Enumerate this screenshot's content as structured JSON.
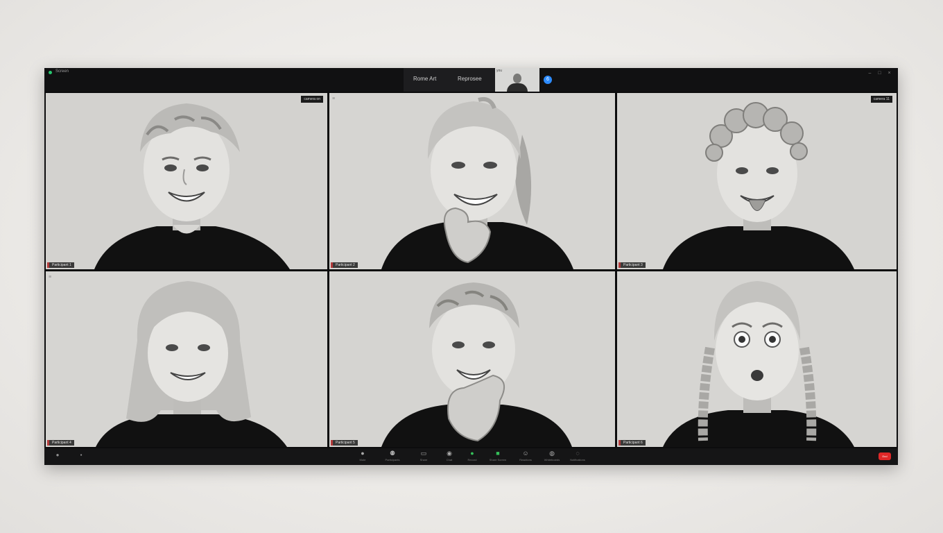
{
  "window": {
    "title": "Screen",
    "nav_left": "Rome Art",
    "nav_right": "Reprosee",
    "self_view_label": "you",
    "participants_badge": "6"
  },
  "colors": {
    "background": "#eceae7",
    "frame": "#0c0c0d",
    "tile_bg": "#d6d5d2",
    "accent_blue": "#2d8cff",
    "end_red": "#e02828",
    "name_tag_accent": "#b23a3a"
  },
  "tiles": [
    {
      "name": "Participant 1",
      "status": "camera on",
      "expression": "smiling",
      "hair": "wavy-short"
    },
    {
      "name": "Participant 2",
      "status": "",
      "expression": "laughing, hand on chin",
      "hair": "ponytail"
    },
    {
      "name": "Participant 3",
      "status": "camera 11",
      "expression": "tongue out",
      "hair": "curly"
    },
    {
      "name": "Participant 4",
      "status": "",
      "expression": "smiling",
      "hair": "shoulder-length"
    },
    {
      "name": "Participant 5",
      "status": "",
      "expression": "laughing, hand on mouth",
      "hair": "wavy-short"
    },
    {
      "name": "Participant 6",
      "status": "",
      "expression": "surprised",
      "hair": "braids"
    }
  ],
  "toolbar": {
    "left_items": [
      {
        "icon": "mic-icon",
        "label": ""
      },
      {
        "icon": "camera-icon",
        "label": ""
      }
    ],
    "items": [
      {
        "icon": "mute-icon",
        "label": "Mute"
      },
      {
        "icon": "participants-icon",
        "label": "Participants"
      },
      {
        "icon": "share-icon",
        "label": "Share"
      },
      {
        "icon": "chat-icon",
        "label": "Chat"
      },
      {
        "icon": "record-icon",
        "label": "Record"
      },
      {
        "icon": "share-screen-icon",
        "label": "Share Screen"
      },
      {
        "icon": "reactions-icon",
        "label": "Reactions"
      },
      {
        "icon": "apps-icon",
        "label": "Whiteboards"
      },
      {
        "icon": "more-icon",
        "label": "Notifications"
      }
    ],
    "end_label": "End"
  }
}
